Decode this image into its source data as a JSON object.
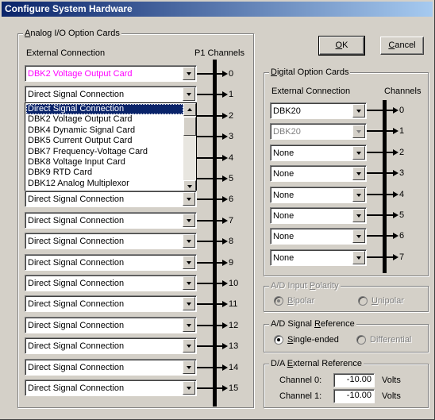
{
  "window": {
    "title": "Configure System Hardware"
  },
  "buttons": {
    "ok": {
      "prefix": "",
      "mnemonic": "O",
      "suffix": "K"
    },
    "cancel": {
      "prefix": "",
      "mnemonic": "C",
      "suffix": "ancel"
    }
  },
  "analog": {
    "group_label": {
      "prefix": "",
      "mnemonic": "A",
      "suffix": "nalog I/O Option Cards"
    },
    "col_external": "External Connection",
    "col_channels": "P1 Channels",
    "accent_color": "#ff00ff",
    "rows": [
      {
        "value": "DBK2 Voltage Output Card",
        "channel": "0",
        "highlight": true
      },
      {
        "value": "Direct Signal Connection",
        "channel": "1"
      },
      {
        "value": "",
        "channel": "2"
      },
      {
        "value": "",
        "channel": "3"
      },
      {
        "value": "",
        "channel": "4"
      },
      {
        "value": "",
        "channel": "5"
      },
      {
        "value": "Direct Signal Connection",
        "channel": "6"
      },
      {
        "value": "Direct Signal Connection",
        "channel": "7"
      },
      {
        "value": "Direct Signal Connection",
        "channel": "8"
      },
      {
        "value": "Direct Signal Connection",
        "channel": "9"
      },
      {
        "value": "Direct Signal Connection",
        "channel": "10"
      },
      {
        "value": "Direct Signal Connection",
        "channel": "11"
      },
      {
        "value": "Direct Signal Connection",
        "channel": "12"
      },
      {
        "value": "Direct Signal Connection",
        "channel": "13"
      },
      {
        "value": "Direct Signal Connection",
        "channel": "14"
      },
      {
        "value": "Direct Signal Connection",
        "channel": "15"
      }
    ],
    "dropdown_items": [
      {
        "label": "Direct Signal Connection",
        "selected": true
      },
      {
        "label": "DBK2 Voltage Output Card"
      },
      {
        "label": "DBK4 Dynamic Signal Card"
      },
      {
        "label": "DBK5 Current Output Card"
      },
      {
        "label": "DBK7 Frequency-Voltage Card"
      },
      {
        "label": "DBK8 Voltage Input Card"
      },
      {
        "label": "DBK9 RTD Card"
      },
      {
        "label": "DBK12 Analog Multiplexor"
      }
    ]
  },
  "digital": {
    "group_label": {
      "prefix": "",
      "mnemonic": "D",
      "suffix": "igital Option Cards"
    },
    "col_external": "External Connection",
    "col_channels": "Channels",
    "rows": [
      {
        "value": "DBK20",
        "channel": "0"
      },
      {
        "value": "DBK20",
        "channel": "1",
        "disabled": true
      },
      {
        "value": "None",
        "channel": "2"
      },
      {
        "value": "None",
        "channel": "3"
      },
      {
        "value": "None",
        "channel": "4"
      },
      {
        "value": "None",
        "channel": "5"
      },
      {
        "value": "None",
        "channel": "6"
      },
      {
        "value": "None",
        "channel": "7"
      }
    ]
  },
  "ad_polarity": {
    "group_label": {
      "prefix": "A/D Input ",
      "mnemonic": "P",
      "suffix": "olarity"
    },
    "bipolar": {
      "prefix": "",
      "mnemonic": "B",
      "suffix": "ipolar"
    },
    "unipolar": {
      "prefix": "",
      "mnemonic": "U",
      "suffix": "nipolar"
    },
    "selected": "bipolar"
  },
  "ad_signal": {
    "group_label": {
      "prefix": "A/D Signal ",
      "mnemonic": "R",
      "suffix": "eference"
    },
    "single": {
      "prefix": "",
      "mnemonic": "S",
      "suffix": "ingle-ended"
    },
    "differential": "Differential",
    "selected": "single"
  },
  "da_ref": {
    "group_label": {
      "prefix": "D/A ",
      "mnemonic": "E",
      "suffix": "xternal Reference"
    },
    "channel0_label": "Channel 0:",
    "channel0_value": "-10.00",
    "channel1_label": "Channel 1:",
    "channel1_value": "-10.00",
    "unit": "Volts"
  }
}
